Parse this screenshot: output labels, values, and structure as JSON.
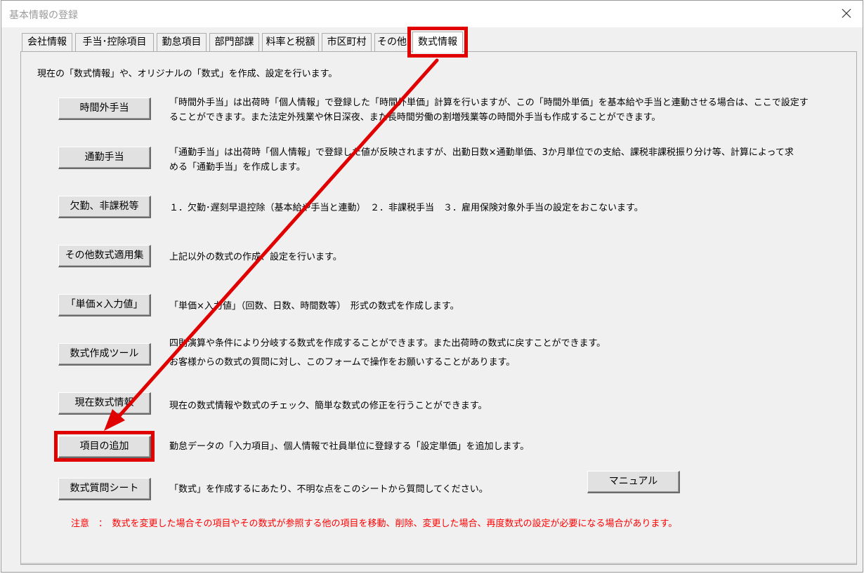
{
  "window": {
    "title": "基本情報の登録"
  },
  "tabs": [
    {
      "label": "会社情報"
    },
    {
      "label": "手当･控除項目"
    },
    {
      "label": "勤怠項目"
    },
    {
      "label": "部門部課"
    },
    {
      "label": "料率と税額"
    },
    {
      "label": "市区町村"
    },
    {
      "label": "その他"
    },
    {
      "label": "数式情報"
    }
  ],
  "active_tab": "数式情報",
  "panel": {
    "intro": "現在の「数式情報」や、オリジナルの「数式」を作成、設定を行います。",
    "items": [
      {
        "button": "時間外手当",
        "desc1": "「時間外手当」は出荷時「個人情報」で登録した「時間外単価」計算を行いますが、この「時間外単価」を基本給や手当と連動させる場合は、ここで設定す",
        "desc2": "ることができます。また法定外残業や休日深夜、また長時間労働の割増残業等の時間外手当も作成することができます。"
      },
      {
        "button": "通勤手当",
        "desc1": "「通勤手当」は出荷時「個人情報」で登録した値が反映されますが、出勤日数×通勤単価、3か月単位での支給、課税非課税振り分け等、計算によって求",
        "desc2": "める「通勤手当」を作成します。"
      },
      {
        "button": "欠勤、非課税等",
        "desc1": "１．欠勤･遅刻早退控除（基本給や手当と連動）　２．非課税手当　３．雇用保険対象外手当の設定をおこないます。"
      },
      {
        "button": "その他数式適用集",
        "desc1": "上記以外の数式の作成、設定を行います。"
      },
      {
        "button": "「単価×入力値」",
        "desc1": "「単価×入力値」（回数、日数、時間数等）　形式の数式を作成します。"
      },
      {
        "button": "数式作成ツール",
        "desc1": "四則演算や条件により分岐する数式を作成することができます。また出荷時の数式に戻すことができます。",
        "desc2": "お客様からの数式の質問に対し、このフォームで操作をお願いすることがあります。"
      },
      {
        "button": "現在数式情報",
        "desc1": "現在の数式情報や数式のチェック、簡単な数式の修正を行うことができます。"
      },
      {
        "button": "項目の追加",
        "desc1": "勤怠データの「入力項目」、個人情報で社員単位に登録する「設定単価」を追加します。"
      },
      {
        "button": "数式質問シート",
        "desc1": "「数式」を作成するにあたり、不明な点をこのシートから質問してください。"
      }
    ],
    "manual_button": "マニュアル",
    "warning": "注意　：　数式を変更した場合その項目やその数式が参照する他の項目を移動、削除、変更した場合、再度数式の設定が必要になる場合があります。"
  },
  "colors": {
    "highlight": "#e00000",
    "warning_text": "#ff0000",
    "background": "#f0f0f0"
  },
  "icons": {
    "close": "close-icon"
  }
}
